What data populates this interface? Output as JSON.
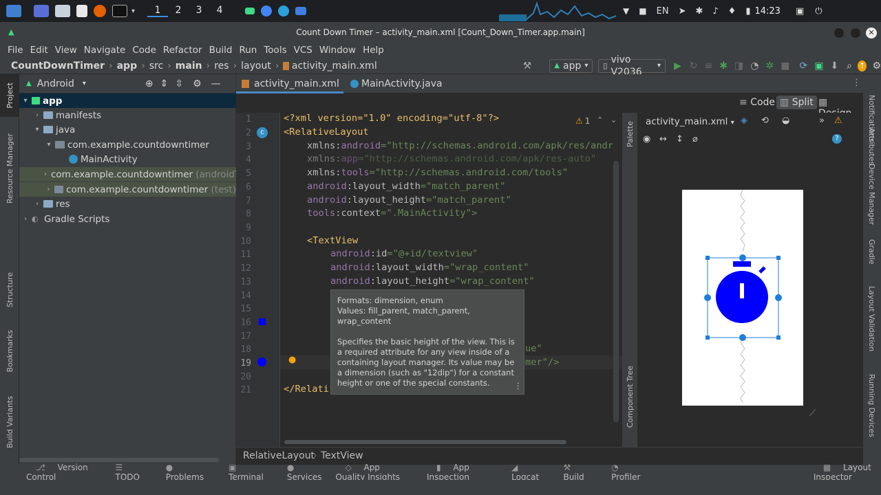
{
  "taskbar": {
    "workspaces": [
      "1",
      "2",
      "3",
      "4"
    ],
    "language": "EN",
    "time": "14:23"
  },
  "window_title": "Count Down Timer – activity_main.xml [Count_Down_Timer.app.main]",
  "menu": [
    "File",
    "Edit",
    "View",
    "Navigate",
    "Code",
    "Refactor",
    "Build",
    "Run",
    "Tools",
    "VCS",
    "Window",
    "Help"
  ],
  "breadcrumb": [
    "CountDownTimer",
    "app",
    "src",
    "main",
    "res",
    "layout",
    "activity_main.xml"
  ],
  "toolbar": {
    "module": "app",
    "device": "vivo V2036"
  },
  "left_strip": [
    "Project",
    "Resource Manager",
    "Structure",
    "Bookmarks",
    "Build Variants"
  ],
  "right_strip": [
    "Notifications",
    "Attributes",
    "Device Manager",
    "Gradle",
    "Layout Validation",
    "Running Devices"
  ],
  "project": {
    "view": "Android",
    "tree": [
      {
        "label": "app",
        "suffix": ""
      },
      {
        "label": "manifests",
        "suffix": ""
      },
      {
        "label": "java",
        "suffix": ""
      },
      {
        "label": "com.example.countdowntimer",
        "suffix": ""
      },
      {
        "label": "MainActivity",
        "suffix": ""
      },
      {
        "label": "com.example.countdowntimer",
        "suffix": "(androidTest)"
      },
      {
        "label": "com.example.countdowntimer",
        "suffix": "(test)"
      },
      {
        "label": "res",
        "suffix": ""
      },
      {
        "label": "Gradle Scripts",
        "suffix": ""
      }
    ]
  },
  "tabs": [
    "activity_main.xml",
    "MainActivity.java"
  ],
  "view_modes": [
    "Code",
    "Split",
    "Design"
  ],
  "warning_count": "1",
  "code": {
    "line_numbers": [
      "1",
      "2",
      "3",
      "4",
      "5",
      "6",
      "7",
      "8",
      "9",
      "10",
      "11",
      "12",
      "13",
      "14",
      "15",
      "16",
      "17",
      "18",
      "19",
      "20",
      "21"
    ],
    "l1": "<?xml version=\"1.0\" encoding=\"utf-8\"?>",
    "l2": "<RelativeLayout",
    "l3_ns": "xmlns:",
    "l3_attr": "android",
    "l3_val": "=\"http://schemas.android.com/apk/res/andr",
    "l4_ns": "xmlns:",
    "l4_attr": "app",
    "l4_val": "=\"http://schemas.android.com/apk/res-auto\"",
    "l5_ns": "xmlns:",
    "l5_attr": "tools",
    "l5_val": "=\"http://schemas.android.com/tools\"",
    "l6_ns": "android",
    "l6_attr": ":layout_width",
    "l6_val": "=\"match_parent\"",
    "l7_ns": "android",
    "l7_attr": ":layout_height",
    "l7_val": "=\"match_parent\"",
    "l8_ns": "tools",
    "l8_attr": ":context",
    "l8_val": "=\".MainActivity\">",
    "l10": "<TextView",
    "l11_ns": "android",
    "l11_attr": ":id",
    "l11_val": "=\"@+id/textview\"",
    "l12_ns": "android",
    "l12_attr": ":layout_width",
    "l12_val": "=\"wrap_content\"",
    "l13_ns": "android",
    "l13_attr": ":layout_height",
    "l13_val": "=\"wrap_content\"",
    "l18_tail": "ue\"",
    "l19_tail": "mer\"/>",
    "l21": "</Relati"
  },
  "tooltip": {
    "formats": "Formats: dimension, enum",
    "values": "Values: fill_parent, match_parent, wrap_content",
    "description": "Specifies the basic height of the view. This is a required attribute for any view inside of a containing layout manager. Its value may be a dimension (such as \"12dip\") for a constant height or one of the special constants."
  },
  "design": {
    "file": "activity_main.xml",
    "palette": "Palette",
    "component_tree": "Component Tree"
  },
  "bottom_crumbs": [
    "RelativeLayout",
    "TextView"
  ],
  "tool_windows": [
    "Version Control",
    "TODO",
    "Problems",
    "Terminal",
    "Services",
    "App Quality Insights",
    "App Inspection",
    "Logcat",
    "Build",
    "Profiler",
    "Layout Inspector"
  ],
  "colors": {
    "accent": "#4a88c7",
    "preview_icon": "#0000ff",
    "selection": "#1f7ddb"
  }
}
